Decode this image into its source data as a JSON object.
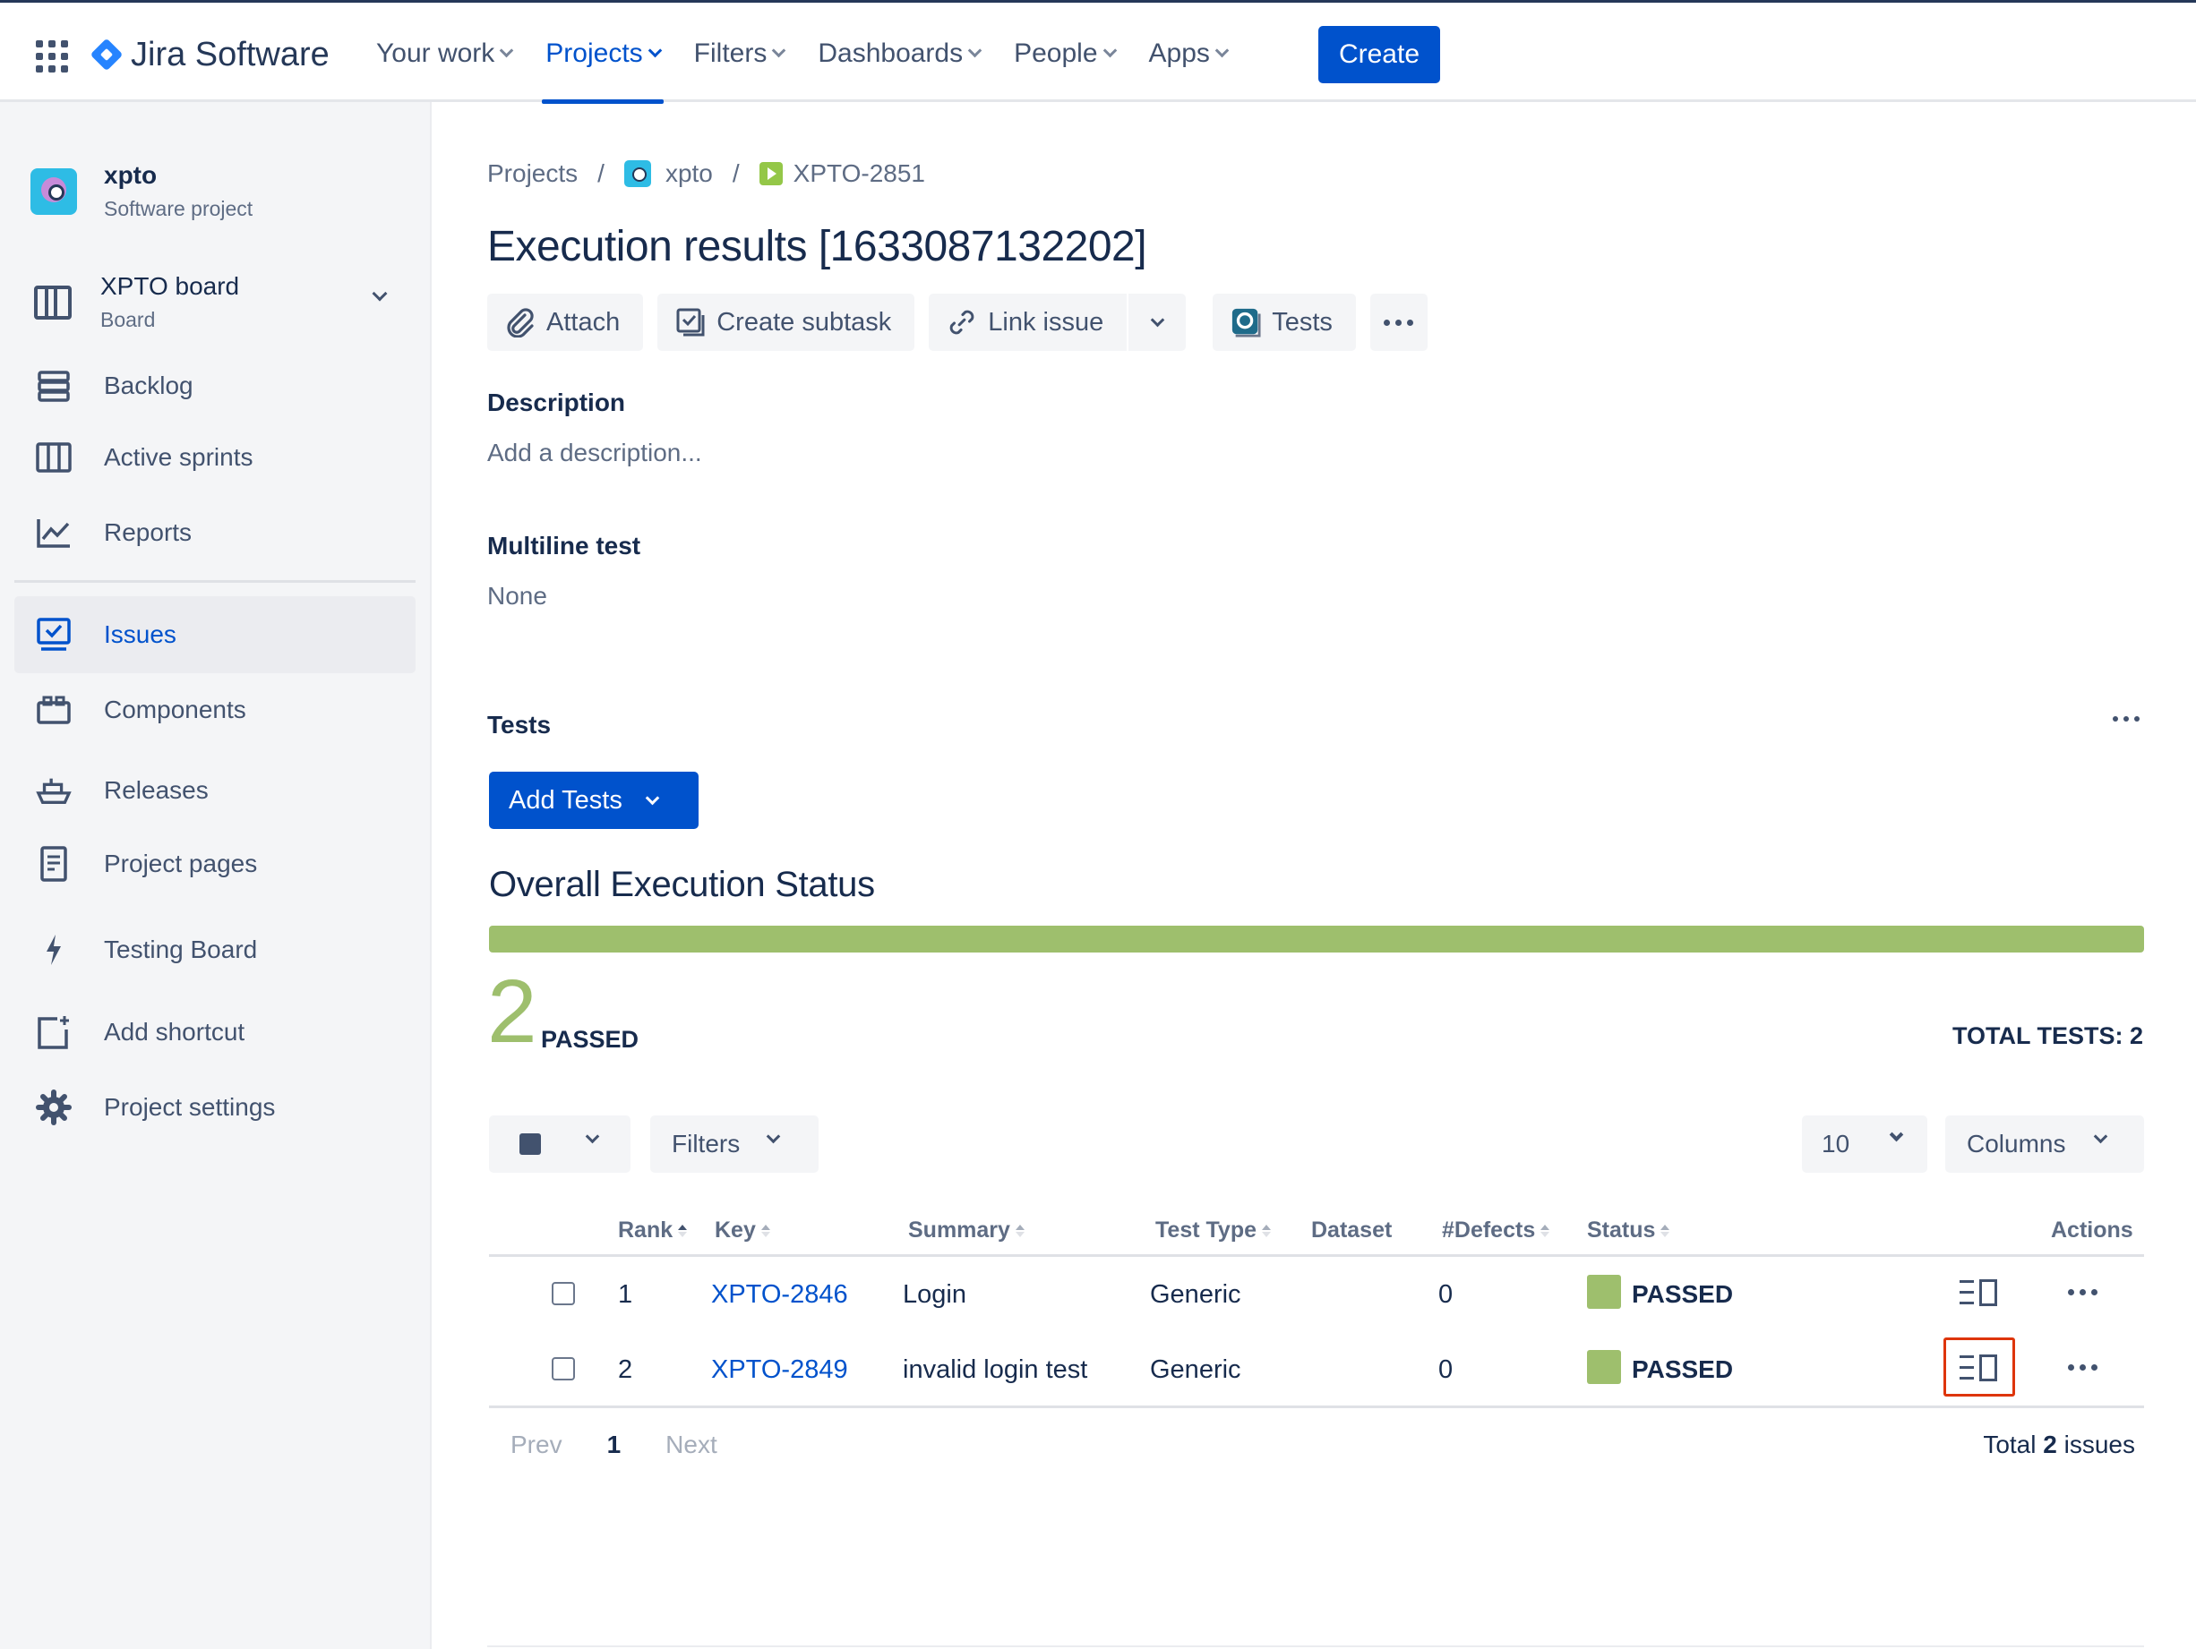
{
  "nav": {
    "logo": "Jira Software",
    "items": [
      {
        "label": "Your work",
        "active": false
      },
      {
        "label": "Projects",
        "active": true
      },
      {
        "label": "Filters",
        "active": false
      },
      {
        "label": "Dashboards",
        "active": false
      },
      {
        "label": "People",
        "active": false
      },
      {
        "label": "Apps",
        "active": false
      }
    ],
    "create_label": "Create"
  },
  "sidebar": {
    "project_name": "xpto",
    "project_type": "Software project",
    "board_name": "XPTO board",
    "board_sub": "Board",
    "items": [
      {
        "label": "Backlog",
        "icon": "backlog-icon"
      },
      {
        "label": "Active sprints",
        "icon": "sprints-icon"
      },
      {
        "label": "Reports",
        "icon": "reports-icon"
      },
      {
        "label": "Issues",
        "icon": "issues-icon",
        "selected": true
      },
      {
        "label": "Components",
        "icon": "components-icon"
      },
      {
        "label": "Releases",
        "icon": "releases-icon"
      },
      {
        "label": "Project pages",
        "icon": "pages-icon"
      },
      {
        "label": "Testing Board",
        "icon": "lightning-icon"
      },
      {
        "label": "Add shortcut",
        "icon": "add-shortcut-icon"
      },
      {
        "label": "Project settings",
        "icon": "gear-icon"
      }
    ]
  },
  "breadcrumb": {
    "projects": "Projects",
    "sep": "/",
    "project": "xpto",
    "issue_key": "XPTO-2851"
  },
  "issue": {
    "title": "Execution results [1633087132202]"
  },
  "toolbar": {
    "attach": "Attach",
    "create_subtask": "Create subtask",
    "link_issue": "Link issue",
    "tests": "Tests"
  },
  "description": {
    "label": "Description",
    "placeholder": "Add a description..."
  },
  "multiline": {
    "label": "Multiline test",
    "value": "None"
  },
  "tests_section": {
    "label": "Tests",
    "add_tests": "Add Tests",
    "overall_title": "Overall Execution Status",
    "passed_fraction": 1.0,
    "passed_count": "2",
    "passed_label": "PASSED",
    "total_tests": "TOTAL TESTS: 2",
    "pass_color": "#9ebf6d"
  },
  "controls": {
    "filters": "Filters",
    "page_size": "10",
    "columns": "Columns"
  },
  "table": {
    "headers": {
      "rank": "Rank",
      "key": "Key",
      "summary": "Summary",
      "test_type": "Test Type",
      "dataset": "Dataset",
      "defects": "#Defects",
      "status": "Status",
      "actions": "Actions"
    },
    "rows": [
      {
        "rank": "1",
        "key": "XPTO-2846",
        "summary": "Login",
        "test_type": "Generic",
        "defects": "0",
        "status": "PASSED"
      },
      {
        "rank": "2",
        "key": "XPTO-2849",
        "summary": "invalid login test",
        "test_type": "Generic",
        "defects": "0",
        "status": "PASSED"
      }
    ]
  },
  "pager": {
    "prev": "Prev",
    "current": "1",
    "next": "Next",
    "total_prefix": "Total",
    "total_count": "2",
    "total_suffix": "issues"
  }
}
